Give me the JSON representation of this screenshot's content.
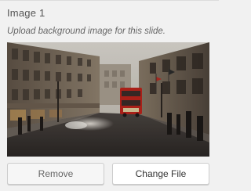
{
  "slide": {
    "title": "Image 1",
    "description": "Upload background image for this slide.",
    "image_alt": "London street with red bus"
  },
  "buttons": {
    "remove_label": "Remove",
    "change_label": "Change File"
  }
}
